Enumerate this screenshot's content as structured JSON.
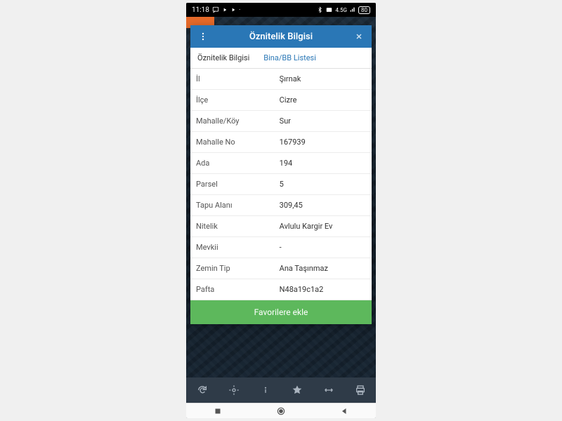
{
  "status": {
    "time": "11:18",
    "icons_left": [
      "cast-icon",
      "play-icon",
      "play-icon"
    ],
    "icons_right": [
      "bluetooth-icon",
      "mail-icon",
      "signal-4g-icon",
      "battery-icon"
    ],
    "battery_text": "80"
  },
  "modal": {
    "title": "Öznitelik Bilgisi",
    "tabs": [
      {
        "label": "Öznitelik Bilgisi",
        "active": true
      },
      {
        "label": "Bina/BB Listesi",
        "active": false
      }
    ],
    "rows": [
      {
        "k": "İl",
        "v": "Şırnak"
      },
      {
        "k": "İlçe",
        "v": "Cizre"
      },
      {
        "k": "Mahalle/Köy",
        "v": "Sur"
      },
      {
        "k": "Mahalle No",
        "v": "167939"
      },
      {
        "k": "Ada",
        "v": "194"
      },
      {
        "k": "Parsel",
        "v": "5"
      },
      {
        "k": "Tapu Alanı",
        "v": "309,45"
      },
      {
        "k": "Nitelik",
        "v": "Avlulu Kargir Ev"
      },
      {
        "k": "Mevkii",
        "v": "-"
      },
      {
        "k": "Zemin Tip",
        "v": "Ana Taşınmaz"
      },
      {
        "k": "Pafta",
        "v": "N48a19c1a2"
      }
    ],
    "favorite_label": "Favorilere ekle"
  },
  "toolbar": {
    "items": [
      "refresh-icon",
      "locate-icon",
      "info-icon",
      "star-icon",
      "measure-icon",
      "print-icon"
    ]
  }
}
